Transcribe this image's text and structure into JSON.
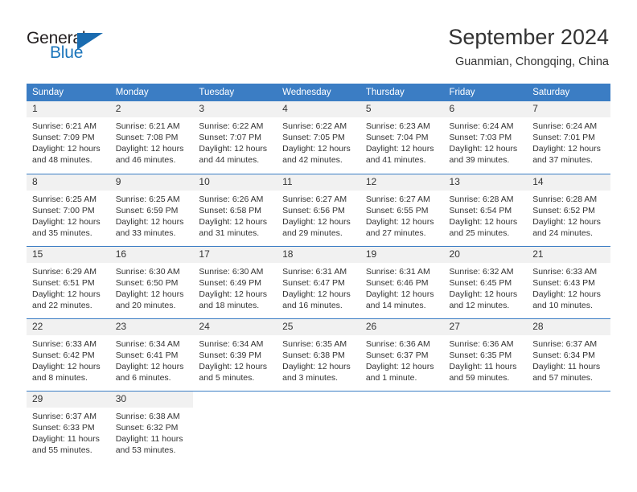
{
  "brand": {
    "name_top": "General",
    "name_bottom": "Blue"
  },
  "header": {
    "title": "September 2024",
    "subtitle": "Guanmian, Chongqing, China"
  },
  "colors": {
    "header_blue": "#3b7dc4",
    "brand_blue": "#1b75bb",
    "daynum_bg": "#f1f1f1",
    "text": "#333333"
  },
  "weekday_headers": [
    "Sunday",
    "Monday",
    "Tuesday",
    "Wednesday",
    "Thursday",
    "Friday",
    "Saturday"
  ],
  "weeks": [
    [
      {
        "day": "1",
        "sunrise": "Sunrise: 6:21 AM",
        "sunset": "Sunset: 7:09 PM",
        "daylight_1": "Daylight: 12 hours",
        "daylight_2": "and 48 minutes."
      },
      {
        "day": "2",
        "sunrise": "Sunrise: 6:21 AM",
        "sunset": "Sunset: 7:08 PM",
        "daylight_1": "Daylight: 12 hours",
        "daylight_2": "and 46 minutes."
      },
      {
        "day": "3",
        "sunrise": "Sunrise: 6:22 AM",
        "sunset": "Sunset: 7:07 PM",
        "daylight_1": "Daylight: 12 hours",
        "daylight_2": "and 44 minutes."
      },
      {
        "day": "4",
        "sunrise": "Sunrise: 6:22 AM",
        "sunset": "Sunset: 7:05 PM",
        "daylight_1": "Daylight: 12 hours",
        "daylight_2": "and 42 minutes."
      },
      {
        "day": "5",
        "sunrise": "Sunrise: 6:23 AM",
        "sunset": "Sunset: 7:04 PM",
        "daylight_1": "Daylight: 12 hours",
        "daylight_2": "and 41 minutes."
      },
      {
        "day": "6",
        "sunrise": "Sunrise: 6:24 AM",
        "sunset": "Sunset: 7:03 PM",
        "daylight_1": "Daylight: 12 hours",
        "daylight_2": "and 39 minutes."
      },
      {
        "day": "7",
        "sunrise": "Sunrise: 6:24 AM",
        "sunset": "Sunset: 7:01 PM",
        "daylight_1": "Daylight: 12 hours",
        "daylight_2": "and 37 minutes."
      }
    ],
    [
      {
        "day": "8",
        "sunrise": "Sunrise: 6:25 AM",
        "sunset": "Sunset: 7:00 PM",
        "daylight_1": "Daylight: 12 hours",
        "daylight_2": "and 35 minutes."
      },
      {
        "day": "9",
        "sunrise": "Sunrise: 6:25 AM",
        "sunset": "Sunset: 6:59 PM",
        "daylight_1": "Daylight: 12 hours",
        "daylight_2": "and 33 minutes."
      },
      {
        "day": "10",
        "sunrise": "Sunrise: 6:26 AM",
        "sunset": "Sunset: 6:58 PM",
        "daylight_1": "Daylight: 12 hours",
        "daylight_2": "and 31 minutes."
      },
      {
        "day": "11",
        "sunrise": "Sunrise: 6:27 AM",
        "sunset": "Sunset: 6:56 PM",
        "daylight_1": "Daylight: 12 hours",
        "daylight_2": "and 29 minutes."
      },
      {
        "day": "12",
        "sunrise": "Sunrise: 6:27 AM",
        "sunset": "Sunset: 6:55 PM",
        "daylight_1": "Daylight: 12 hours",
        "daylight_2": "and 27 minutes."
      },
      {
        "day": "13",
        "sunrise": "Sunrise: 6:28 AM",
        "sunset": "Sunset: 6:54 PM",
        "daylight_1": "Daylight: 12 hours",
        "daylight_2": "and 25 minutes."
      },
      {
        "day": "14",
        "sunrise": "Sunrise: 6:28 AM",
        "sunset": "Sunset: 6:52 PM",
        "daylight_1": "Daylight: 12 hours",
        "daylight_2": "and 24 minutes."
      }
    ],
    [
      {
        "day": "15",
        "sunrise": "Sunrise: 6:29 AM",
        "sunset": "Sunset: 6:51 PM",
        "daylight_1": "Daylight: 12 hours",
        "daylight_2": "and 22 minutes."
      },
      {
        "day": "16",
        "sunrise": "Sunrise: 6:30 AM",
        "sunset": "Sunset: 6:50 PM",
        "daylight_1": "Daylight: 12 hours",
        "daylight_2": "and 20 minutes."
      },
      {
        "day": "17",
        "sunrise": "Sunrise: 6:30 AM",
        "sunset": "Sunset: 6:49 PM",
        "daylight_1": "Daylight: 12 hours",
        "daylight_2": "and 18 minutes."
      },
      {
        "day": "18",
        "sunrise": "Sunrise: 6:31 AM",
        "sunset": "Sunset: 6:47 PM",
        "daylight_1": "Daylight: 12 hours",
        "daylight_2": "and 16 minutes."
      },
      {
        "day": "19",
        "sunrise": "Sunrise: 6:31 AM",
        "sunset": "Sunset: 6:46 PM",
        "daylight_1": "Daylight: 12 hours",
        "daylight_2": "and 14 minutes."
      },
      {
        "day": "20",
        "sunrise": "Sunrise: 6:32 AM",
        "sunset": "Sunset: 6:45 PM",
        "daylight_1": "Daylight: 12 hours",
        "daylight_2": "and 12 minutes."
      },
      {
        "day": "21",
        "sunrise": "Sunrise: 6:33 AM",
        "sunset": "Sunset: 6:43 PM",
        "daylight_1": "Daylight: 12 hours",
        "daylight_2": "and 10 minutes."
      }
    ],
    [
      {
        "day": "22",
        "sunrise": "Sunrise: 6:33 AM",
        "sunset": "Sunset: 6:42 PM",
        "daylight_1": "Daylight: 12 hours",
        "daylight_2": "and 8 minutes."
      },
      {
        "day": "23",
        "sunrise": "Sunrise: 6:34 AM",
        "sunset": "Sunset: 6:41 PM",
        "daylight_1": "Daylight: 12 hours",
        "daylight_2": "and 6 minutes."
      },
      {
        "day": "24",
        "sunrise": "Sunrise: 6:34 AM",
        "sunset": "Sunset: 6:39 PM",
        "daylight_1": "Daylight: 12 hours",
        "daylight_2": "and 5 minutes."
      },
      {
        "day": "25",
        "sunrise": "Sunrise: 6:35 AM",
        "sunset": "Sunset: 6:38 PM",
        "daylight_1": "Daylight: 12 hours",
        "daylight_2": "and 3 minutes."
      },
      {
        "day": "26",
        "sunrise": "Sunrise: 6:36 AM",
        "sunset": "Sunset: 6:37 PM",
        "daylight_1": "Daylight: 12 hours",
        "daylight_2": "and 1 minute."
      },
      {
        "day": "27",
        "sunrise": "Sunrise: 6:36 AM",
        "sunset": "Sunset: 6:35 PM",
        "daylight_1": "Daylight: 11 hours",
        "daylight_2": "and 59 minutes."
      },
      {
        "day": "28",
        "sunrise": "Sunrise: 6:37 AM",
        "sunset": "Sunset: 6:34 PM",
        "daylight_1": "Daylight: 11 hours",
        "daylight_2": "and 57 minutes."
      }
    ],
    [
      {
        "day": "29",
        "sunrise": "Sunrise: 6:37 AM",
        "sunset": "Sunset: 6:33 PM",
        "daylight_1": "Daylight: 11 hours",
        "daylight_2": "and 55 minutes."
      },
      {
        "day": "30",
        "sunrise": "Sunrise: 6:38 AM",
        "sunset": "Sunset: 6:32 PM",
        "daylight_1": "Daylight: 11 hours",
        "daylight_2": "and 53 minutes."
      },
      {
        "day": "",
        "sunrise": "",
        "sunset": "",
        "daylight_1": "",
        "daylight_2": ""
      },
      {
        "day": "",
        "sunrise": "",
        "sunset": "",
        "daylight_1": "",
        "daylight_2": ""
      },
      {
        "day": "",
        "sunrise": "",
        "sunset": "",
        "daylight_1": "",
        "daylight_2": ""
      },
      {
        "day": "",
        "sunrise": "",
        "sunset": "",
        "daylight_1": "",
        "daylight_2": ""
      },
      {
        "day": "",
        "sunrise": "",
        "sunset": "",
        "daylight_1": "",
        "daylight_2": ""
      }
    ]
  ]
}
